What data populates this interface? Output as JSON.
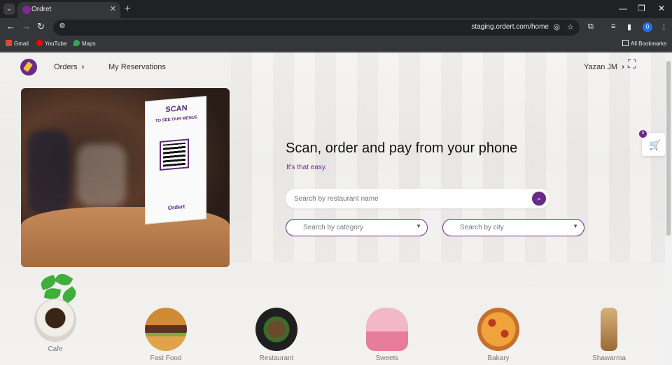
{
  "browser": {
    "tab_title": "Ordret",
    "url": "staging.ordert.com/home",
    "profile_initial": "0",
    "bookmarks": [
      {
        "label": "Gmail",
        "icon": "gmail-icon",
        "color": "#ea4335"
      },
      {
        "label": "YouTube",
        "icon": "youtube-icon",
        "color": "#ff0000"
      },
      {
        "label": "Maps",
        "icon": "maps-icon",
        "color": "#34a853"
      }
    ],
    "all_bookmarks": "All Bookmarks"
  },
  "header": {
    "nav": [
      {
        "label": "Orders",
        "has_chevron": true
      },
      {
        "label": "My Reservations",
        "has_chevron": false
      }
    ],
    "user_name": "Yazan JM",
    "accent": "#6a2a8a"
  },
  "hero": {
    "image_text": {
      "scan": "SCAN",
      "sub": "TO SEE OUR MENUS",
      "brand": "Ordert"
    },
    "headline": "Scan, order and pay from your phone",
    "subline": "It's that easy.",
    "search_placeholder": "Search by restaurant name",
    "category_placeholder": "Search by category",
    "city_placeholder": "Search by city"
  },
  "cart": {
    "count": "0"
  },
  "categories": [
    {
      "label": "Cafe",
      "color": "#e6e1dc"
    },
    {
      "label": "Fast Food",
      "color": "#c7852e"
    },
    {
      "label": "Restaurant",
      "color": "#2b2b2b"
    },
    {
      "label": "Sweets",
      "color": "#e9a1b8"
    },
    {
      "label": "Bakary",
      "color": "#d9692b"
    },
    {
      "label": "Shawarma",
      "color": "#c9a26a"
    }
  ]
}
